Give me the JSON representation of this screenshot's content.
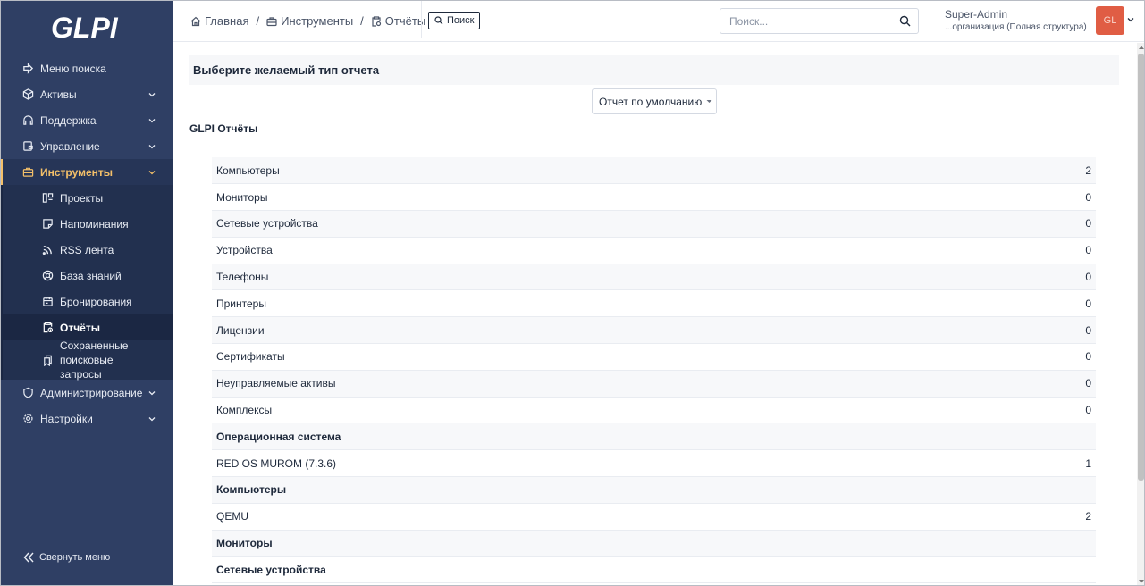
{
  "colors": {
    "sidebar_bg": "#2f3f64",
    "accent": "#f4c069",
    "avatar_bg": "#e05d44"
  },
  "logo": {
    "text": "GLPI"
  },
  "sidebar": {
    "items": [
      {
        "label": "Меню поиска",
        "icon": "arrow-right-icon"
      },
      {
        "label": "Активы",
        "icon": "box-icon"
      },
      {
        "label": "Поддержка",
        "icon": "headset-icon"
      },
      {
        "label": "Управление",
        "icon": "wallet-icon"
      },
      {
        "label": "Инструменты",
        "icon": "briefcase-icon"
      }
    ],
    "sub_items": [
      {
        "label": "Проекты",
        "icon": "layout-icon"
      },
      {
        "label": "Напоминания",
        "icon": "note-icon"
      },
      {
        "label": "RSS лента",
        "icon": "rss-icon"
      },
      {
        "label": "База знаний",
        "icon": "lifebuoy-icon"
      },
      {
        "label": "Бронирования",
        "icon": "calendar-icon"
      },
      {
        "label": "Отчёты",
        "icon": "report-icon"
      },
      {
        "label_line1": "Сохраненные",
        "label_line2": "поисковые запросы",
        "icon": "bookmarks-icon"
      }
    ],
    "bottom_items": [
      {
        "label": "Администрирование",
        "icon": "shield-icon"
      },
      {
        "label": "Настройки",
        "icon": "gear-icon"
      }
    ],
    "collapse_label": "Свернуть меню"
  },
  "header": {
    "breadcrumb": [
      "Главная",
      "Инструменты",
      "Отчёты"
    ],
    "search_button": "Поиск",
    "search_placeholder": "Поиск...",
    "user_name": "Super-Admin",
    "user_entity": "...организация (Полная структура)",
    "avatar_initials": "GL"
  },
  "main": {
    "card_title": "Выберите желаемый тип отчета",
    "select_value": "Отчет по умолчанию",
    "section_title": "GLPI Отчёты",
    "rows": [
      {
        "label": "Компьютеры",
        "value": "2",
        "group": false
      },
      {
        "label": "Мониторы",
        "value": "0",
        "group": false
      },
      {
        "label": "Сетевые устройства",
        "value": "0",
        "group": false
      },
      {
        "label": "Устройства",
        "value": "0",
        "group": false
      },
      {
        "label": "Телефоны",
        "value": "0",
        "group": false
      },
      {
        "label": "Принтеры",
        "value": "0",
        "group": false
      },
      {
        "label": "Лицензии",
        "value": "0",
        "group": false
      },
      {
        "label": "Сертификаты",
        "value": "0",
        "group": false
      },
      {
        "label": "Неуправляемые активы",
        "value": "0",
        "group": false
      },
      {
        "label": "Комплексы",
        "value": "0",
        "group": false
      },
      {
        "label": "Операционная система",
        "value": "",
        "group": true
      },
      {
        "label": "RED OS MUROM (7.3.6)",
        "value": "1",
        "group": false
      },
      {
        "label": "Компьютеры",
        "value": "",
        "group": true
      },
      {
        "label": "QEMU",
        "value": "2",
        "group": false
      },
      {
        "label": "Мониторы",
        "value": "",
        "group": true
      },
      {
        "label": "Сетевые устройства",
        "value": "",
        "group": true
      }
    ]
  }
}
